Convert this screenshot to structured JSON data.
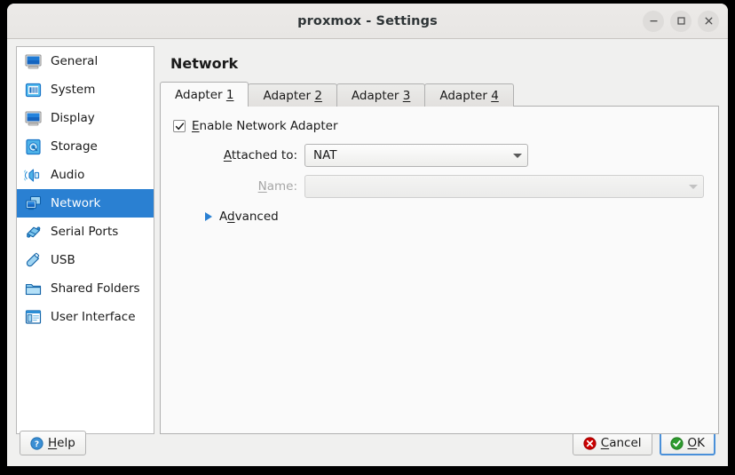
{
  "window": {
    "title": "proxmox - Settings",
    "controls": [
      {
        "name": "minimize",
        "glyph": "–"
      },
      {
        "name": "maximize",
        "glyph": "□"
      },
      {
        "name": "close",
        "glyph": "✕"
      }
    ]
  },
  "sidebar": {
    "items": [
      {
        "label": "General",
        "icon": "monitor-icon",
        "selected": false
      },
      {
        "label": "System",
        "icon": "motherboard-icon",
        "selected": false
      },
      {
        "label": "Display",
        "icon": "display-icon",
        "selected": false
      },
      {
        "label": "Storage",
        "icon": "harddisk-icon",
        "selected": false
      },
      {
        "label": "Audio",
        "icon": "speaker-icon",
        "selected": false
      },
      {
        "label": "Network",
        "icon": "network-icon",
        "selected": true
      },
      {
        "label": "Serial Ports",
        "icon": "serial-port-icon",
        "selected": false
      },
      {
        "label": "USB",
        "icon": "usb-icon",
        "selected": false
      },
      {
        "label": "Shared Folders",
        "icon": "folder-icon",
        "selected": false
      },
      {
        "label": "User Interface",
        "icon": "user-interface-icon",
        "selected": false
      }
    ]
  },
  "pane": {
    "title": "Network",
    "tabs": [
      {
        "label": "Adapter 1",
        "accel": "1",
        "active": true
      },
      {
        "label": "Adapter 2",
        "accel": "2",
        "active": false
      },
      {
        "label": "Adapter 3",
        "accel": "3",
        "active": false
      },
      {
        "label": "Adapter 4",
        "accel": "4",
        "active": false
      }
    ],
    "form": {
      "enable_adapter": {
        "label": "Enable Network Adapter",
        "accel": "E",
        "checked": true
      },
      "attached_to": {
        "label": "Attached to:",
        "accel": "A",
        "value": "NAT",
        "enabled": true
      },
      "name": {
        "label": "Name:",
        "accel": "N",
        "value": "",
        "enabled": false
      },
      "advanced": {
        "label": "Advanced",
        "accel": "d",
        "expanded": false
      }
    }
  },
  "footer": {
    "help": {
      "label": "Help",
      "accel": "H",
      "icon": "help-icon"
    },
    "cancel": {
      "label": "Cancel",
      "accel": "C",
      "icon": "cancel-icon"
    },
    "ok": {
      "label": "OK",
      "accel": "O",
      "icon": "ok-icon",
      "default": true
    }
  },
  "colors": {
    "selection_blue": "#2a80d2",
    "focus_blue": "#4a90d9",
    "cancel_red": "#cc0000",
    "ok_green": "#2e9b2e",
    "help_blue": "#3b8fd4",
    "window_bg": "#f0f0ef",
    "panel_bg": "#fafafa"
  }
}
